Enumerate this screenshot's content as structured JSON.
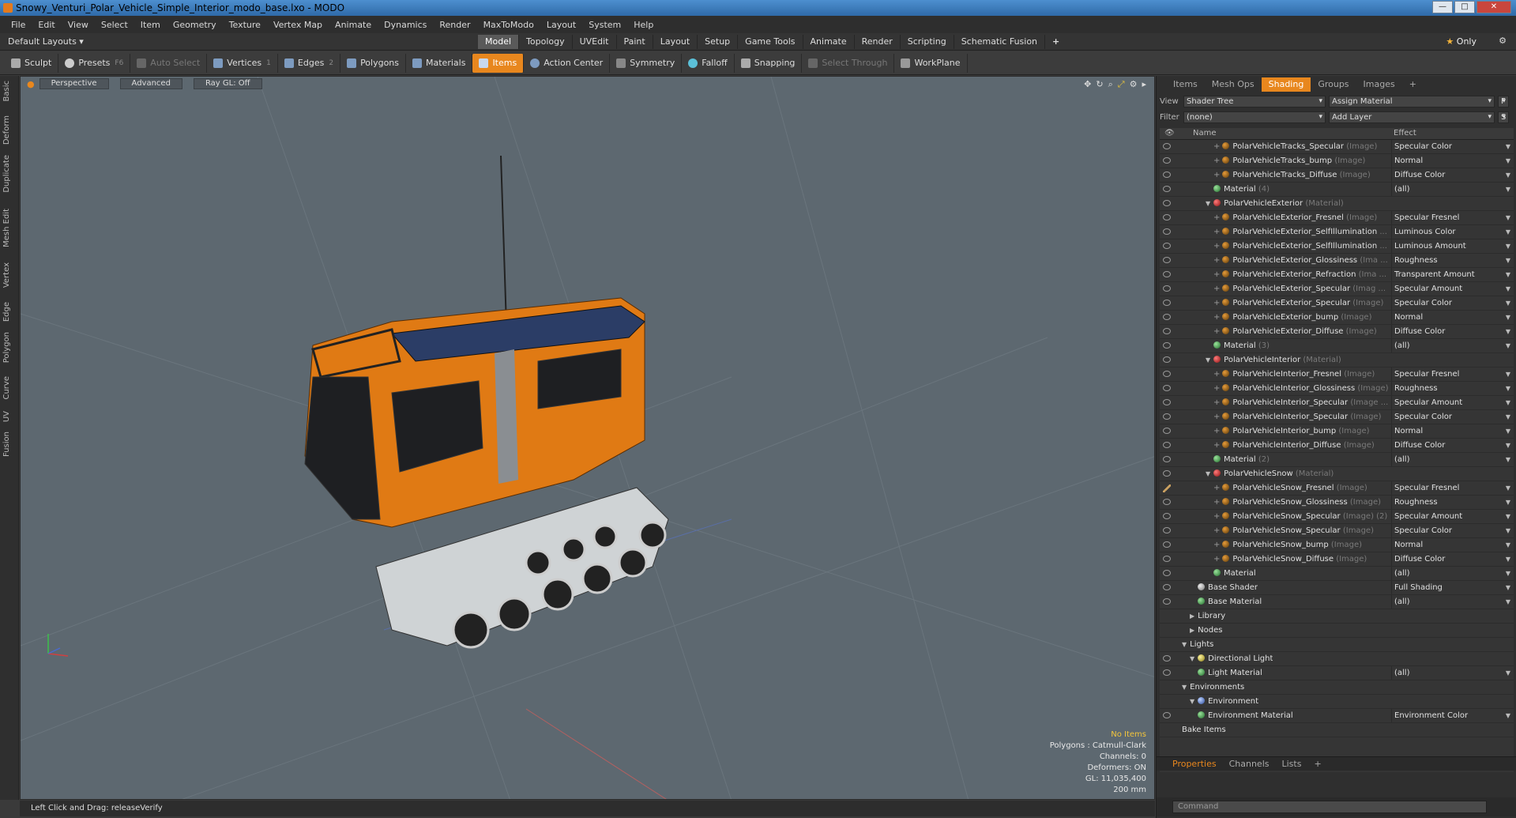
{
  "window": {
    "title": "Snowy_Venturi_Polar_Vehicle_Simple_Interior_modo_base.lxo - MODO",
    "min": "—",
    "max": "□",
    "close": "✕"
  },
  "menu": [
    "File",
    "Edit",
    "View",
    "Select",
    "Item",
    "Geometry",
    "Texture",
    "Vertex Map",
    "Animate",
    "Dynamics",
    "Render",
    "MaxToModo",
    "Layout",
    "System",
    "Help"
  ],
  "layouts": {
    "selector": "Default Layouts ▾",
    "tabs": [
      "Model",
      "Topology",
      "UVEdit",
      "Paint",
      "Layout",
      "Setup",
      "Game Tools",
      "Animate",
      "Render",
      "Scripting",
      "Schematic Fusion"
    ],
    "active": "Model",
    "plus": "+",
    "only": "Only",
    "star": "★"
  },
  "toolbar": {
    "sculpt": "Sculpt",
    "presets": "Presets",
    "presets_key": "F6",
    "auto_select": "Auto Select",
    "vertices": "Vertices",
    "vertices_key": "1",
    "edges": "Edges",
    "edges_key": "2",
    "polygons": "Polygons",
    "materials": "Materials",
    "items": "Items",
    "action_center": "Action Center",
    "symmetry": "Symmetry",
    "falloff": "Falloff",
    "snapping": "Snapping",
    "select_through": "Select Through",
    "workplane": "WorkPlane"
  },
  "left_tabs": [
    "Basic",
    "Deform",
    "Duplicate",
    "Mesh Edit",
    "Vertex",
    "Edge",
    "Polygon",
    "Curve",
    "UV",
    "Fusion"
  ],
  "viewport": {
    "perspective": "Perspective",
    "advanced": "Advanced",
    "raygl": "Ray GL: Off",
    "info": {
      "no_items": "No Items",
      "polygons": "Polygons : Catmull-Clark",
      "channels": "Channels: 0",
      "deformers": "Deformers: ON",
      "gl": "GL: 11,035,400",
      "scale": "200 mm"
    }
  },
  "status": {
    "text": "Left Click and Drag:   releaseVerify"
  },
  "panel": {
    "tabs": [
      "Items",
      "Mesh Ops",
      "Shading",
      "Groups",
      "Images"
    ],
    "active_tab": "Shading",
    "plus": "+",
    "view_label": "View",
    "view_value": "Shader Tree",
    "assign_material": "Assign Material",
    "f_btn": "F",
    "filter_label": "Filter",
    "filter_value": "(none)",
    "add_layer": "Add Layer",
    "s_btn": "S",
    "col_name": "Name",
    "col_effect": "Effect",
    "rows": [
      {
        "indent": 5,
        "icon": "img",
        "plus": true,
        "name": "PolarVehicleTracks_Specular",
        "type": "(Image)",
        "effect": "Specular Color"
      },
      {
        "indent": 5,
        "icon": "img",
        "plus": true,
        "name": "PolarVehicleTracks_bump",
        "type": "(Image)",
        "effect": "Normal"
      },
      {
        "indent": 5,
        "icon": "img",
        "plus": true,
        "name": "PolarVehicleTracks_Diffuse",
        "type": "(Image)",
        "effect": "Diffuse Color"
      },
      {
        "indent": 5,
        "icon": "mat",
        "plus": false,
        "name": "Material",
        "type": "(4)",
        "effect": "(all)"
      },
      {
        "indent": 4,
        "icon": "matred",
        "arrow": "▼",
        "name": "PolarVehicleExterior",
        "type": "(Material)",
        "effect": ""
      },
      {
        "indent": 5,
        "icon": "img",
        "plus": true,
        "name": "PolarVehicleExterior_Fresnel",
        "type": "(Image)",
        "effect": "Specular Fresnel"
      },
      {
        "indent": 5,
        "icon": "img",
        "plus": true,
        "name": "PolarVehicleExterior_SelfIllumination",
        "type": "...",
        "effect": "Luminous Color"
      },
      {
        "indent": 5,
        "icon": "img",
        "plus": true,
        "name": "PolarVehicleExterior_SelfIllumination",
        "type": "...",
        "effect": "Luminous Amount"
      },
      {
        "indent": 5,
        "icon": "img",
        "plus": true,
        "name": "PolarVehicleExterior_Glossiness",
        "type": "(Ima ...",
        "effect": "Roughness"
      },
      {
        "indent": 5,
        "icon": "img",
        "plus": true,
        "name": "PolarVehicleExterior_Refraction",
        "type": "(Ima ...",
        "effect": "Transparent Amount"
      },
      {
        "indent": 5,
        "icon": "img",
        "plus": true,
        "name": "PolarVehicleExterior_Specular",
        "type": "(Imag ...",
        "effect": "Specular Amount"
      },
      {
        "indent": 5,
        "icon": "img",
        "plus": true,
        "name": "PolarVehicleExterior_Specular",
        "type": "(Image)",
        "effect": "Specular Color"
      },
      {
        "indent": 5,
        "icon": "img",
        "plus": true,
        "name": "PolarVehicleExterior_bump",
        "type": "(Image)",
        "effect": "Normal"
      },
      {
        "indent": 5,
        "icon": "img",
        "plus": true,
        "name": "PolarVehicleExterior_Diffuse",
        "type": "(Image)",
        "effect": "Diffuse Color"
      },
      {
        "indent": 5,
        "icon": "mat",
        "plus": false,
        "name": "Material",
        "type": "(3)",
        "effect": "(all)"
      },
      {
        "indent": 4,
        "icon": "matred",
        "arrow": "▼",
        "name": "PolarVehicleInterior",
        "type": "(Material)",
        "effect": ""
      },
      {
        "indent": 5,
        "icon": "img",
        "plus": true,
        "name": "PolarVehicleInterior_Fresnel",
        "type": "(Image)",
        "effect": "Specular Fresnel"
      },
      {
        "indent": 5,
        "icon": "img",
        "plus": true,
        "name": "PolarVehicleInterior_Glossiness",
        "type": "(Image)",
        "effect": "Roughness"
      },
      {
        "indent": 5,
        "icon": "img",
        "plus": true,
        "name": "PolarVehicleInterior_Specular",
        "type": "(Image ...",
        "effect": "Specular Amount"
      },
      {
        "indent": 5,
        "icon": "img",
        "plus": true,
        "name": "PolarVehicleInterior_Specular",
        "type": "(Image)",
        "effect": "Specular Color"
      },
      {
        "indent": 5,
        "icon": "img",
        "plus": true,
        "name": "PolarVehicleInterior_bump",
        "type": "(Image)",
        "effect": "Normal"
      },
      {
        "indent": 5,
        "icon": "img",
        "plus": true,
        "name": "PolarVehicleInterior_Diffuse",
        "type": "(Image)",
        "effect": "Diffuse Color"
      },
      {
        "indent": 5,
        "icon": "mat",
        "plus": false,
        "name": "Material",
        "type": "(2)",
        "effect": "(all)"
      },
      {
        "indent": 4,
        "icon": "matred",
        "arrow": "▼",
        "name": "PolarVehicleSnow",
        "type": "(Material)",
        "effect": ""
      },
      {
        "indent": 5,
        "icon": "img",
        "plus": true,
        "brush": true,
        "name": "PolarVehicleSnow_Fresnel",
        "type": "(Image)",
        "effect": "Specular Fresnel"
      },
      {
        "indent": 5,
        "icon": "img",
        "plus": true,
        "name": "PolarVehicleSnow_Glossiness",
        "type": "(Image)",
        "effect": "Roughness"
      },
      {
        "indent": 5,
        "icon": "img",
        "plus": true,
        "name": "PolarVehicleSnow_Specular",
        "type": "(Image) (2)",
        "effect": "Specular Amount"
      },
      {
        "indent": 5,
        "icon": "img",
        "plus": true,
        "name": "PolarVehicleSnow_Specular",
        "type": "(Image)",
        "effect": "Specular Color"
      },
      {
        "indent": 5,
        "icon": "img",
        "plus": true,
        "name": "PolarVehicleSnow_bump",
        "type": "(Image)",
        "effect": "Normal"
      },
      {
        "indent": 5,
        "icon": "img",
        "plus": true,
        "name": "PolarVehicleSnow_Diffuse",
        "type": "(Image)",
        "effect": "Diffuse Color"
      },
      {
        "indent": 5,
        "icon": "mat",
        "plus": false,
        "name": "Material",
        "type": "",
        "effect": "(all)"
      },
      {
        "indent": 3,
        "icon": "shader",
        "name": "Base Shader",
        "type": "",
        "effect": "Full Shading"
      },
      {
        "indent": 3,
        "icon": "mat",
        "name": "Base Material",
        "type": "",
        "effect": "(all)"
      },
      {
        "indent": 2,
        "arrow": "▶",
        "noeye": true,
        "name": "Library",
        "type": "",
        "effect": ""
      },
      {
        "indent": 2,
        "arrow": "▶",
        "noeye": true,
        "name": "Nodes",
        "type": "",
        "effect": ""
      },
      {
        "indent": 1,
        "arrow": "▼",
        "noeye": true,
        "name": "Lights",
        "type": "",
        "effect": ""
      },
      {
        "indent": 2,
        "icon": "light",
        "arrow": "▼",
        "name": "Directional Light",
        "type": "",
        "effect": ""
      },
      {
        "indent": 3,
        "icon": "mat",
        "name": "Light Material",
        "type": "",
        "effect": "(all)"
      },
      {
        "indent": 1,
        "arrow": "▼",
        "noeye": true,
        "name": "Environments",
        "type": "",
        "effect": ""
      },
      {
        "indent": 2,
        "icon": "env",
        "arrow": "▼",
        "noeye": true,
        "name": "Environment",
        "type": "",
        "effect": ""
      },
      {
        "indent": 3,
        "icon": "mat",
        "name": "Environment Material",
        "type": "",
        "effect": "Environment Color"
      },
      {
        "indent": 1,
        "noeye": true,
        "name": "Bake Items",
        "type": "",
        "effect": ""
      }
    ],
    "bottom_tabs": [
      "Properties",
      "Channels",
      "Lists"
    ],
    "bottom_active": "Properties",
    "command_placeholder": "Command"
  },
  "colors": {
    "accent": "#e8871e",
    "vehicle_body": "#e07a14",
    "viewport_bg": "#5d6870"
  }
}
